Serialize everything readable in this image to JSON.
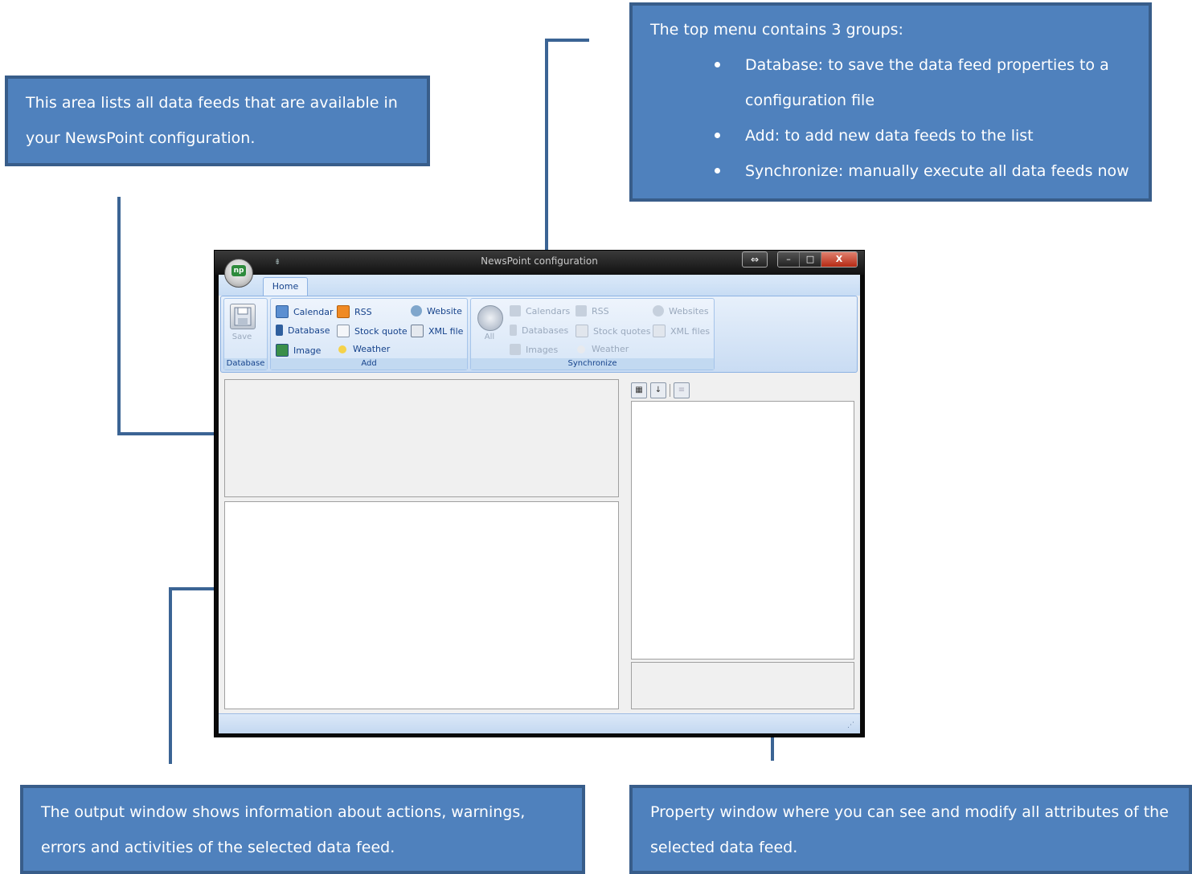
{
  "callouts": {
    "list_area": "This area lists all data feeds that are available in your NewsPoint configuration.",
    "top_menu": {
      "intro": "The top menu contains 3 groups:",
      "items": [
        "Database: to save the data feed properties to a configuration file",
        "Add: to add new data feeds to the list",
        "Synchronize: manually execute all data feeds now"
      ]
    },
    "output": "The output window shows information about actions, warnings, errors and activities of the selected data feed.",
    "property": "Property window where you can see and modify all attributes of the selected data feed."
  },
  "window": {
    "title": "NewsPoint configuration",
    "orb_label": "np",
    "qat_glyph": "⇟",
    "resize_glyph": "⇔",
    "minimize_glyph": "–",
    "maximize_glyph": "□",
    "close_glyph": "X",
    "tab_home": "Home"
  },
  "ribbon": {
    "database": {
      "label": "Database",
      "save": "Save"
    },
    "add": {
      "label": "Add",
      "items": [
        "Calendar",
        "RSS",
        "Website",
        "Database",
        "Stock quote",
        "XML file",
        "Image",
        "Weather"
      ]
    },
    "synchronize": {
      "label": "Synchronize",
      "all": "All",
      "items": [
        "Calendars",
        "RSS",
        "Websites",
        "Databases",
        "Stock quotes",
        "XML files",
        "Images",
        "Weather"
      ]
    }
  },
  "property_toolbar": {
    "categorized": "▦",
    "alphabetical": "↓",
    "pages": "≡"
  },
  "colors": {
    "callout_fill": "#4f81bd",
    "callout_border": "#385d8a",
    "line": "#3b6494",
    "ribbon_text": "#15428b"
  },
  "icons": {
    "calendar": "calendar-icon",
    "rss": "rss-icon",
    "website": "website-icon",
    "database": "database-icon",
    "stock": "stock-quote-icon",
    "xml": "xml-file-icon",
    "image": "image-icon",
    "weather": "weather-icon"
  }
}
